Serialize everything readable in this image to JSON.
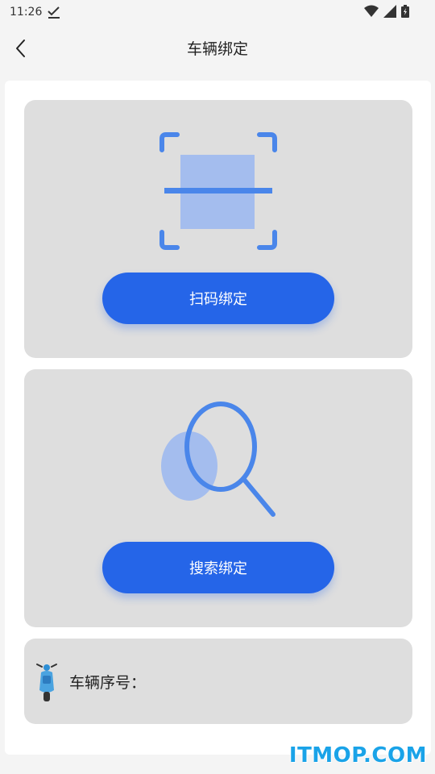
{
  "status_bar": {
    "time": "11:26"
  },
  "nav": {
    "title": "车辆绑定"
  },
  "scan_card": {
    "button_label": "扫码绑定"
  },
  "search_card": {
    "button_label": "搜索绑定"
  },
  "info_card": {
    "label": "车辆序号："
  },
  "watermark": "ITMOP.COM",
  "colors": {
    "accent": "#2565e8",
    "illustration_blue": "#4a86ea",
    "illustration_light": "#a4bdee",
    "card_bg": "#dedede"
  }
}
